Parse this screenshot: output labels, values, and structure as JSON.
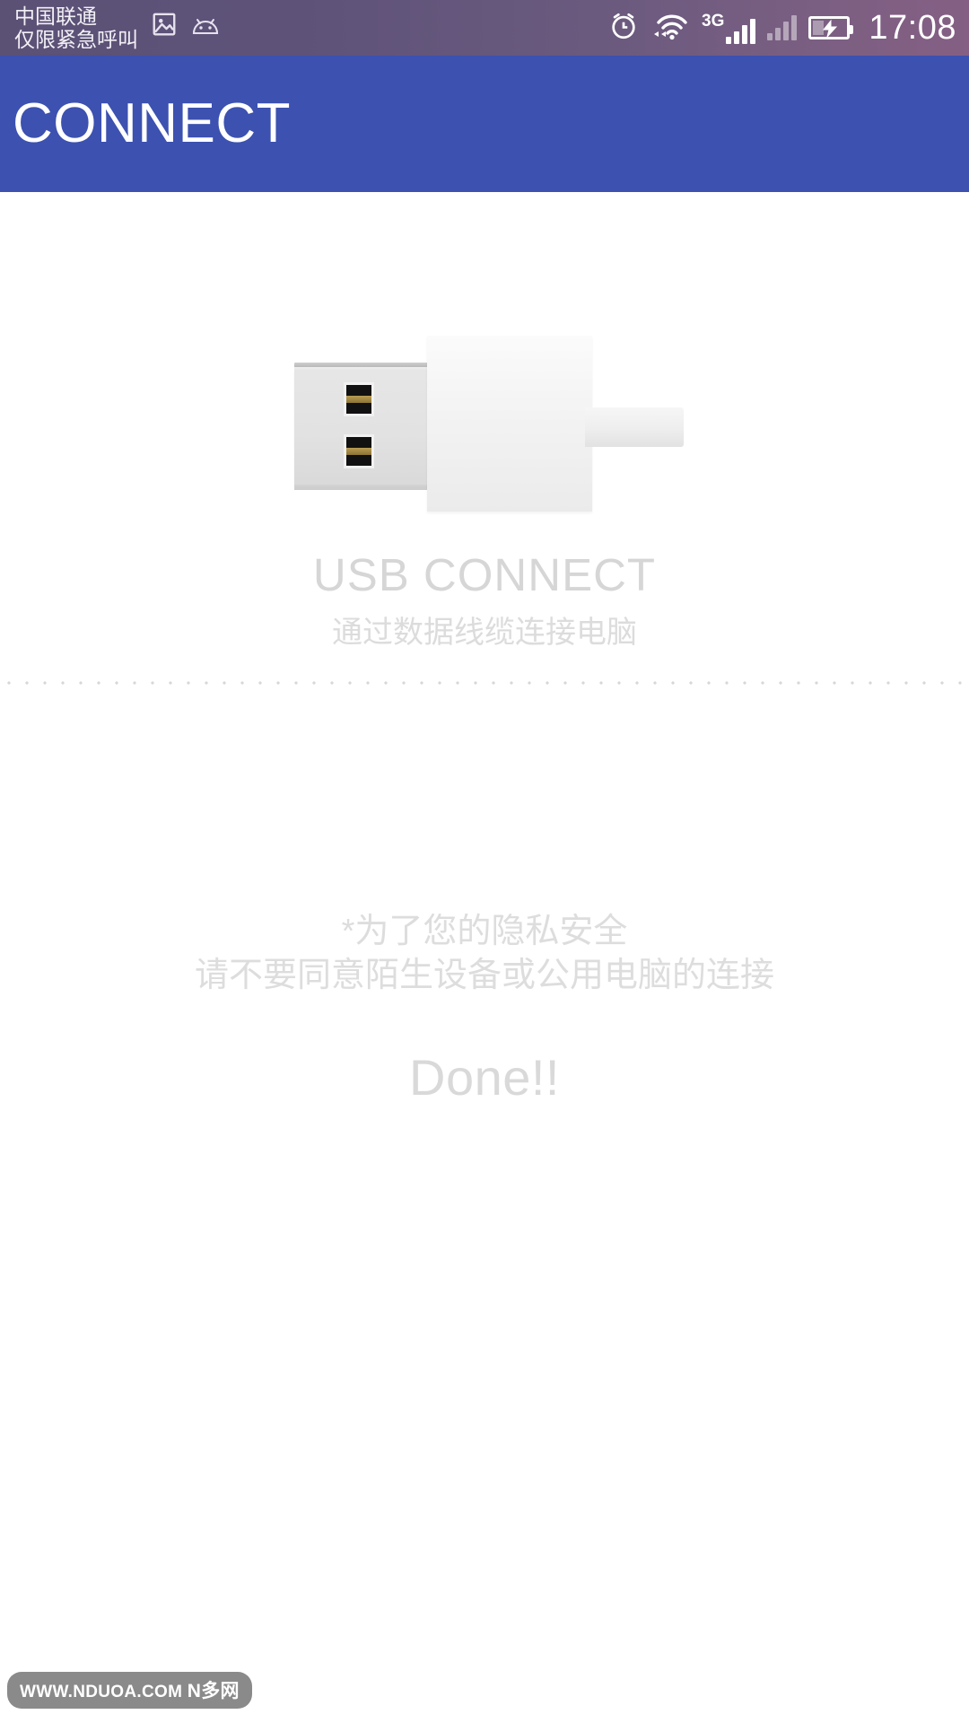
{
  "statusbar": {
    "carrier_line1": "中国联通",
    "carrier_line2": "仅限紧急呼叫",
    "time": "17:08",
    "network_type": "3G",
    "icons": {
      "photo": "photo-icon",
      "android": "android-icon",
      "alarm": "alarm-icon",
      "wifi": "wifi-icon",
      "signal_primary": "signal-bars-icon",
      "signal_secondary": "signal-bars-secondary-icon",
      "battery": "battery-charging-icon"
    }
  },
  "appbar": {
    "title": "CONNECT",
    "background_color": "#3c51b0"
  },
  "usb_section": {
    "title": "USB CONNECT",
    "subtitle": "通过数据线缆连接电脑",
    "illustration": "usb-connector-illustration"
  },
  "notice": {
    "line1": "*为了您的隐私安全",
    "line2": "请不要同意陌生设备或公用电脑的连接",
    "status": "Done!!"
  },
  "watermark": {
    "url": "WWW.NDUOA.COM",
    "name": "N多网"
  },
  "colors": {
    "appbar_blue": "#3c51b0",
    "statusbar_left": "#5b5175",
    "statusbar_right": "#855f84",
    "muted_text": "#dcdcdc",
    "usb_gold": "#b89c52"
  }
}
